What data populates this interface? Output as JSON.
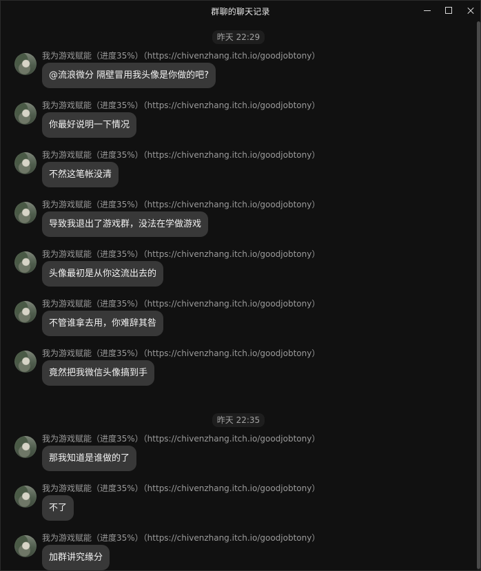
{
  "window": {
    "title": "群聊的聊天记录"
  },
  "groups": [
    {
      "time": "昨天 22:29",
      "messages": [
        {
          "sender": "我为游戏赋能（进度35%）（https://chivenzhang.itch.io/goodjobtony）",
          "text": "@流浪微分 隔壁冒用我头像是你做的吧?"
        },
        {
          "sender": "我为游戏赋能（进度35%）（https://chivenzhang.itch.io/goodjobtony）",
          "text": "你最好说明一下情况"
        },
        {
          "sender": "我为游戏赋能（进度35%）（https://chivenzhang.itch.io/goodjobtony）",
          "text": "不然这笔帐没清"
        },
        {
          "sender": "我为游戏赋能（进度35%）（https://chivenzhang.itch.io/goodjobtony）",
          "text": "导致我退出了游戏群，没法在学做游戏"
        },
        {
          "sender": "我为游戏赋能（进度35%）（https://chivenzhang.itch.io/goodjobtony）",
          "text": "头像最初是从你这流出去的"
        },
        {
          "sender": "我为游戏赋能（进度35%）（https://chivenzhang.itch.io/goodjobtony）",
          "text": "不管谁拿去用，你难辞其咎"
        },
        {
          "sender": "我为游戏赋能（进度35%）（https://chivenzhang.itch.io/goodjobtony）",
          "text": "竟然把我微信头像搞到手"
        }
      ]
    },
    {
      "time": "昨天 22:35",
      "messages": [
        {
          "sender": "我为游戏赋能（进度35%）（https://chivenzhang.itch.io/goodjobtony）",
          "text": "那我知道是谁做的了"
        },
        {
          "sender": "我为游戏赋能（进度35%）（https://chivenzhang.itch.io/goodjobtony）",
          "text": "不了"
        },
        {
          "sender": "我为游戏赋能（进度35%）（https://chivenzhang.itch.io/goodjobtony）",
          "text": "加群讲究缘分"
        }
      ]
    }
  ]
}
